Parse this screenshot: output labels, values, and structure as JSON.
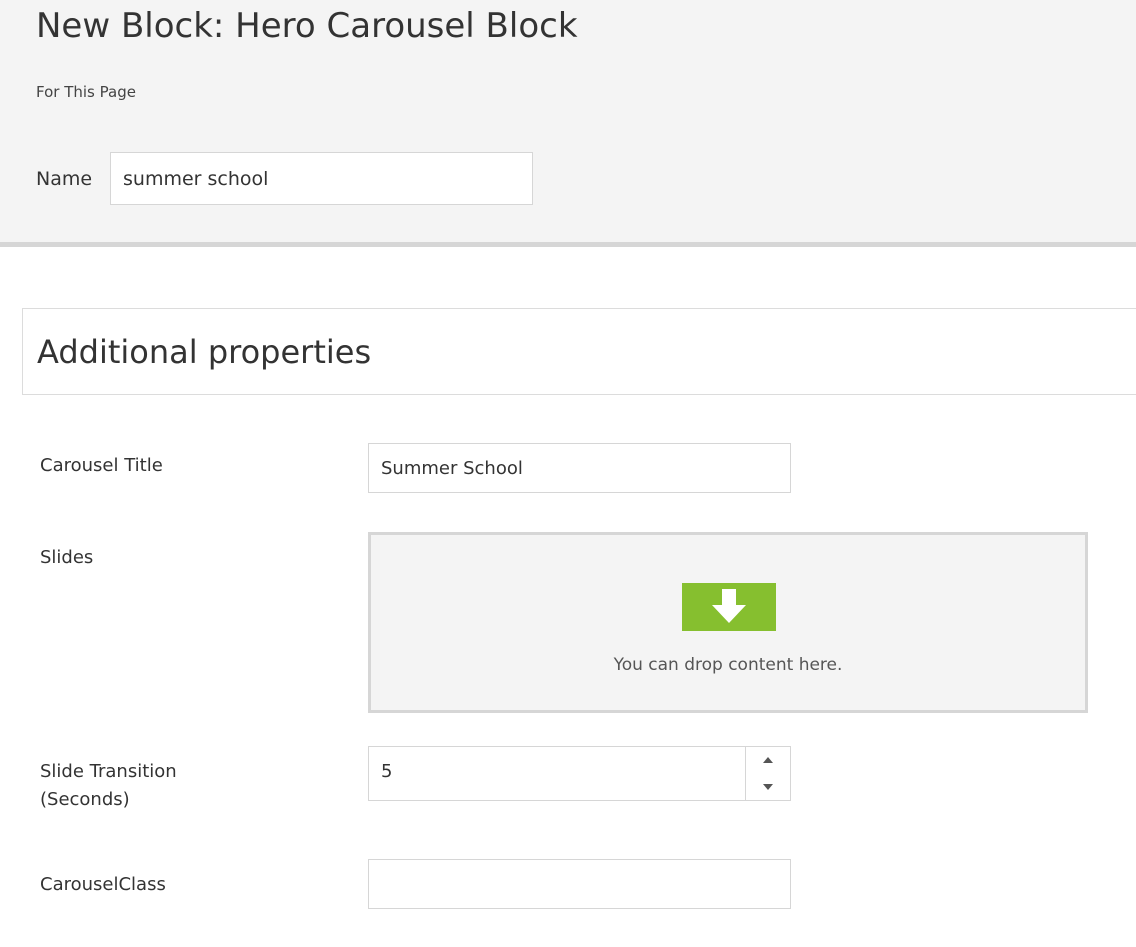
{
  "header": {
    "title": "New Block: Hero Carousel Block",
    "scope": "For This Page",
    "name_label": "Name",
    "name_value": "summer school"
  },
  "section": {
    "title": "Additional properties"
  },
  "fields": {
    "carousel_title": {
      "label": "Carousel Title",
      "value": "Summer School"
    },
    "slides": {
      "label": "Slides",
      "drop_text": "You can drop content here.",
      "drop_icon": "download-arrow-icon"
    },
    "slide_transition": {
      "label_line1": "Slide Transition",
      "label_line2": "(Seconds)",
      "value": "5"
    },
    "carousel_class": {
      "label": "CarouselClass",
      "value": ""
    }
  },
  "colors": {
    "accent_green": "#86bf2f",
    "panel_bg": "#f4f4f4",
    "border": "#d6d6d6"
  }
}
